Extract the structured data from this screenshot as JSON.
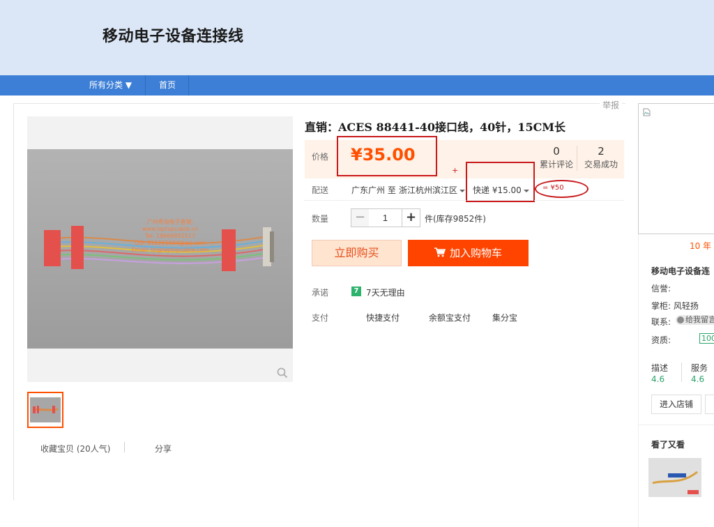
{
  "shop": {
    "title": "移动电子设备连接线"
  },
  "nav": {
    "all_categories": "所有分类 ▼",
    "home": "首页"
  },
  "report": "举报",
  "product": {
    "title": "直销：ACES 88441-40接口线，40针，15CM长",
    "price_label": "价格",
    "price": "¥35.00",
    "reviews": {
      "count": "0",
      "label": "累计评论"
    },
    "deals": {
      "count": "2",
      "label": "交易成功"
    },
    "plus_mark": "+",
    "shipping": {
      "label": "配送",
      "from": "广东广州 至",
      "to": "浙江杭州滨江区",
      "method": "快递 ¥15.00",
      "total_note": "= ¥50"
    },
    "quantity": {
      "label": "数量",
      "value": "1",
      "minus": "−",
      "plus": "+",
      "stock": "件(库存9852件)"
    },
    "buy_now": "立即购买",
    "add_to_cart": "加入购物车",
    "promise": {
      "label": "承诺",
      "badge": "7",
      "text": "7天无理由"
    },
    "payment": {
      "label": "支付",
      "methods": [
        "快捷支付",
        "余额宝支付",
        "集分宝"
      ]
    },
    "watermark": [
      "广州粤海电子直销:",
      "www.laptopcable.cn",
      "Tel: 18666891517",
      "QQ: 811261904@qq.com",
      "Email: lzi@laptopcable.com"
    ]
  },
  "gallery": {
    "favorite": "收藏宝贝 (20人气)",
    "share": "分享"
  },
  "sidebar": {
    "years": "10 年",
    "shop_name": "移动电子设备连",
    "reputation_label": "信誉:",
    "keeper": "掌柜: 风轻扬",
    "contact_label": "联系:",
    "contact_chip": "给我留言",
    "qualification_label": "资质:",
    "qualification_badge": "100",
    "ratings": [
      {
        "label": "描述",
        "value": "4.6"
      },
      {
        "label": "服务",
        "value": "4.6"
      }
    ],
    "enter_shop": "进入店铺",
    "also_viewed": "看了又看"
  },
  "colors": {
    "accent": "#ff5000",
    "nav": "#3d7fd6",
    "header_bg": "#dbe7f7",
    "annotation": "#c8191b",
    "green": "#2aa36a"
  }
}
